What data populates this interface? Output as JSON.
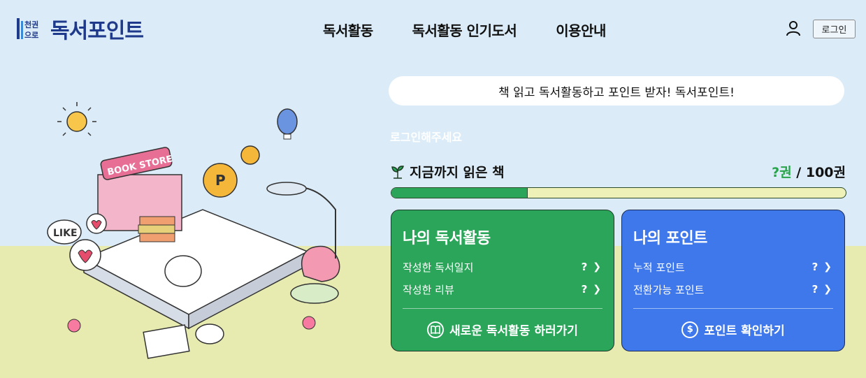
{
  "header": {
    "logo_mark_text": "천권으로",
    "logo_text": "독서포인트",
    "nav": [
      "독서활동",
      "독서활동 인기도서",
      "이용안내"
    ],
    "login_label": "로그인"
  },
  "illustration": {
    "sign_text": "BOOK STORE",
    "like_text": "LIKE"
  },
  "main": {
    "slogan": "책 읽고 독서활동하고 포인트 받자! 독서포인트!",
    "login_prompt": "로그인해주세요",
    "read_label": "지금까지 읽은 책",
    "read_current": "?권",
    "read_total": " / 100권",
    "progress_fraction": 0.3
  },
  "cards": {
    "activity": {
      "title": "나의 독서활동",
      "rows": [
        {
          "label": "작성한 독서일지",
          "value": "?"
        },
        {
          "label": "작성한 리뷰",
          "value": "?"
        }
      ],
      "action": "새로운 독서활동 하러가기",
      "icon": "book-icon"
    },
    "points": {
      "title": "나의 포인트",
      "rows": [
        {
          "label": "누적 포인트",
          "value": "?"
        },
        {
          "label": "전환가능 포인트",
          "value": "?"
        }
      ],
      "action": "포인트 확인하기",
      "icon": "dollar-icon"
    }
  },
  "colors": {
    "sky": "#dbecf8",
    "ground": "#e7ebb0",
    "green_card": "#2aa55a",
    "blue_card": "#3f78ea",
    "logo": "#1f3a8a"
  }
}
